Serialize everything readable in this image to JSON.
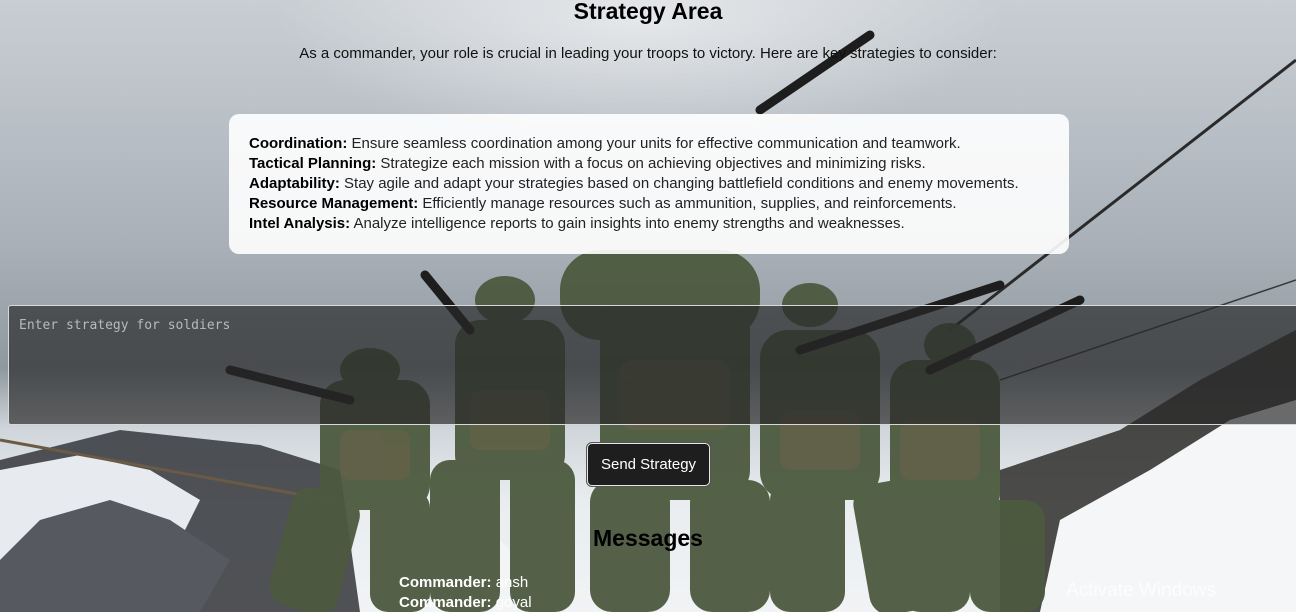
{
  "header": {
    "title": "Strategy Area",
    "intro": "As a commander, your role is crucial in leading your troops to victory. Here are key strategies to consider:"
  },
  "strategies": [
    {
      "label": "Coordination:",
      "text": "Ensure seamless coordination among your units for effective communication and teamwork."
    },
    {
      "label": "Tactical Planning:",
      "text": "Strategize each mission with a focus on achieving objectives and minimizing risks."
    },
    {
      "label": "Adaptability:",
      "text": "Stay agile and adapt your strategies based on changing battlefield conditions and enemy movements."
    },
    {
      "label": "Resource Management:",
      "text": "Efficiently manage resources such as ammunition, supplies, and reinforcements."
    },
    {
      "label": "Intel Analysis:",
      "text": "Analyze intelligence reports to gain insights into enemy strengths and weaknesses."
    }
  ],
  "input": {
    "placeholder": "Enter strategy for soldiers",
    "value": ""
  },
  "send_label": "Send Strategy",
  "messages": {
    "title": "Messages",
    "items": [
      {
        "sender": "Commander:",
        "text": "ansh"
      },
      {
        "sender": "Commander:",
        "text": "goyal"
      }
    ]
  },
  "watermark": "Activate Windows",
  "colors": {
    "button_bg": "#1e1e1e",
    "card_bg": "#ffffff",
    "input_bg": "#282828"
  }
}
